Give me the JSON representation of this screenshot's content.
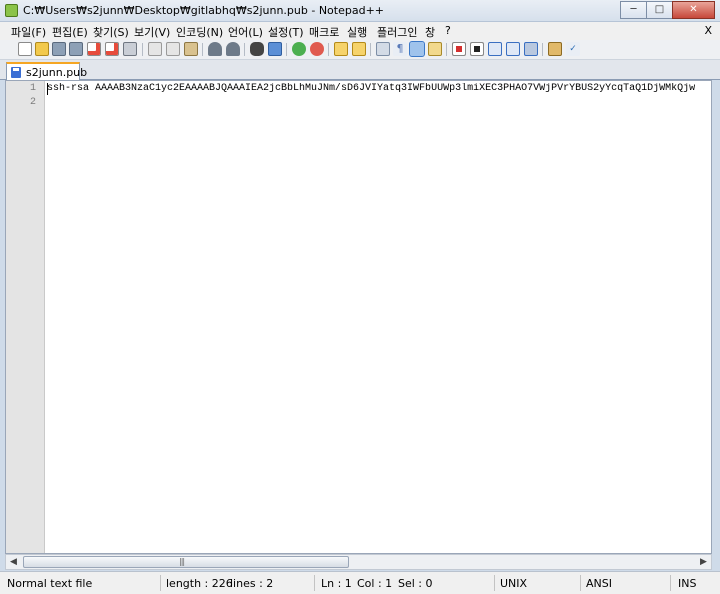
{
  "window": {
    "title": "C:₩Users₩s2junn₩Desktop₩gitlabhq₩s2junn.pub - Notepad++",
    "minimize_glyph": "─",
    "maximize_glyph": "□",
    "close_glyph": "✕"
  },
  "menu": {
    "items": [
      "파일(F)",
      "편집(E)",
      "찾기(S)",
      "보기(V)",
      "인코딩(N)",
      "언어(L)",
      "설정(T)",
      "매크로",
      "실행",
      "플러그인",
      "창",
      "?"
    ],
    "close_doc": "X"
  },
  "toolbar": {
    "icons": [
      "new-file-icon",
      "open-file-icon",
      "save-icon",
      "save-all-icon",
      "close-icon",
      "close-all-icon",
      "print-icon",
      "cut-icon",
      "copy-icon",
      "paste-icon",
      "undo-icon",
      "redo-icon",
      "find-icon",
      "replace-icon",
      "zoom-in-icon",
      "zoom-out-icon",
      "sync-vertical-icon",
      "sync-horizontal-icon",
      "word-wrap-icon",
      "show-all-chars-icon",
      "indent-guide-icon",
      "user-lang-icon",
      "record-macro-icon",
      "stop-record-icon",
      "play-macro-icon",
      "run-macro-multiple-icon",
      "save-macro-icon",
      "monitor-icon",
      "spellcheck-icon"
    ]
  },
  "tab": {
    "label": "s2junn.pub",
    "state": "saved"
  },
  "editor": {
    "line_numbers": [
      "1",
      "2"
    ],
    "lines": [
      "ssh-rsa AAAAB3NzaC1yc2EAAAABJQAAAIEA2jcBbLhMuJNm/sD6JVIYatq3IWFbUUWp3lmiXEC3PHAO7VWjPVrYBUS2yYcqTaQ1DjWMkQjw",
      ""
    ]
  },
  "scrollbar": {
    "left_arrow": "◀",
    "right_arrow": "▶",
    "grip": "|||"
  },
  "status": {
    "doc_type": "Normal text file",
    "length": "length : 226",
    "lines": "lines : 2",
    "ln": "Ln : 1",
    "col": "Col : 1",
    "sel": "Sel : 0",
    "eol": "UNIX",
    "encoding": "ANSI",
    "mode": "INS"
  },
  "colors": {
    "tab_active_accent": "#f5a623",
    "gutter_bg": "#e4e4e4",
    "window_frame": "#cfdbe9"
  }
}
